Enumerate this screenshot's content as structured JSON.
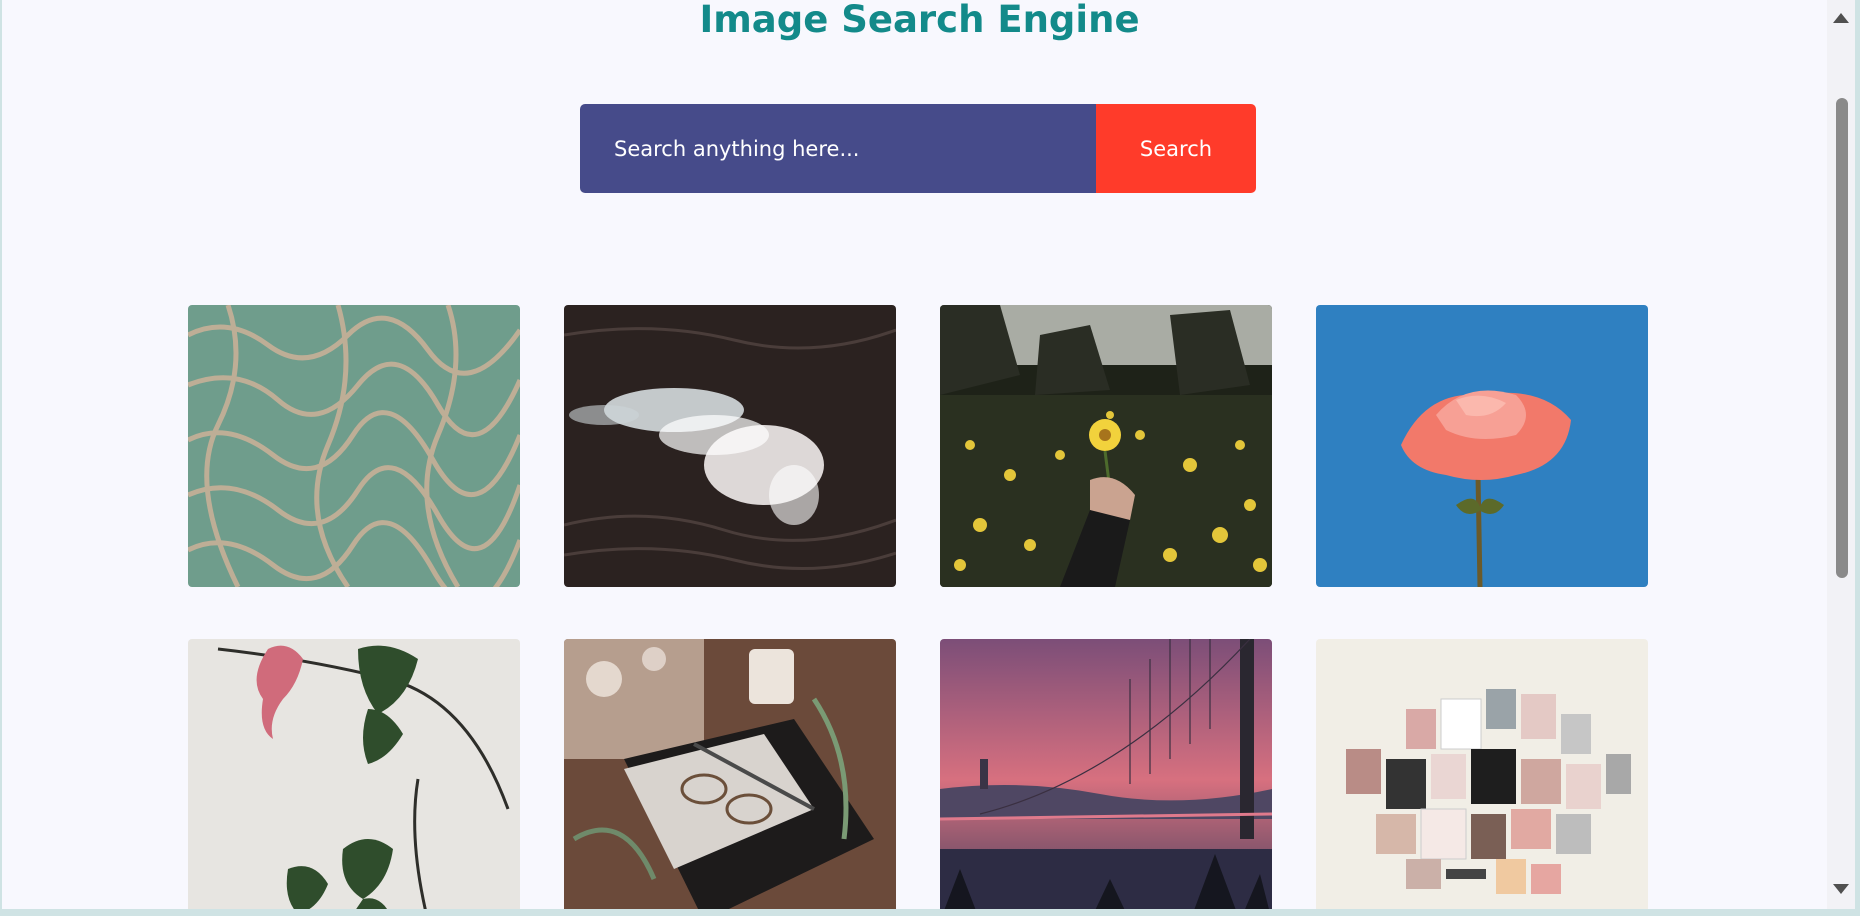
{
  "header": {
    "title": "Image Search Engine"
  },
  "search": {
    "placeholder": "Search anything here...",
    "button_label": "Search"
  },
  "colors": {
    "title": "#138a8a",
    "input_background": "#464b8a",
    "search_button": "#ff3b2a",
    "page_background": "#f8f8fe"
  },
  "results": [
    {
      "subject": "water-ripples"
    },
    {
      "subject": "ocean-wave"
    },
    {
      "subject": "hand-holding-yellow-daisy"
    },
    {
      "subject": "pink-rose-blue-sky"
    },
    {
      "subject": "hibiscus-branch"
    },
    {
      "subject": "book-glasses-candle"
    },
    {
      "subject": "bridge-at-pink-sunset"
    },
    {
      "subject": "photo-collage-wall"
    }
  ]
}
